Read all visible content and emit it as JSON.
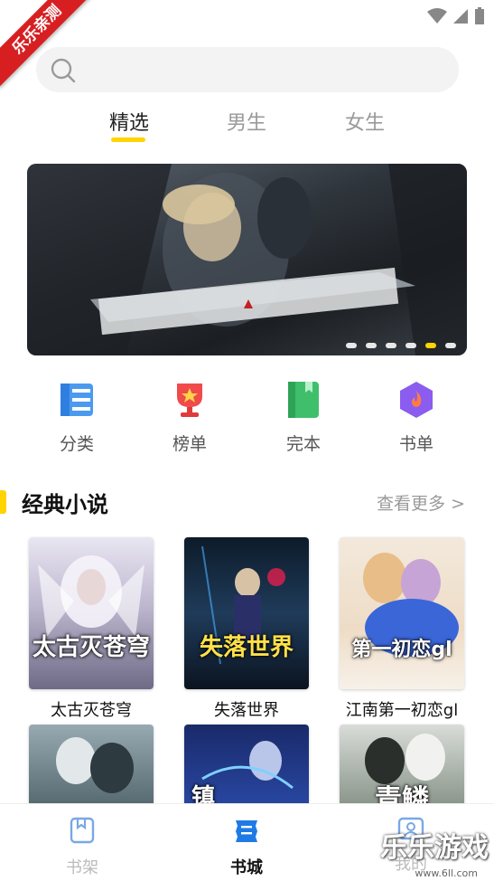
{
  "status_bar": {
    "ribbon_text": "乐乐亲测"
  },
  "search": {
    "placeholder": ""
  },
  "top_tabs": [
    {
      "label": "精选",
      "active": true
    },
    {
      "label": "男生",
      "active": false
    },
    {
      "label": "女生",
      "active": false
    }
  ],
  "banner": {
    "slides": 6,
    "active_slide": 5
  },
  "quick_entries": [
    {
      "label": "分类",
      "icon": "category-icon"
    },
    {
      "label": "榜单",
      "icon": "trophy-icon"
    },
    {
      "label": "完本",
      "icon": "finished-book-icon"
    },
    {
      "label": "书单",
      "icon": "booklist-icon"
    }
  ],
  "section": {
    "title": "经典小说",
    "more": "查看更多 >"
  },
  "books": [
    {
      "title": "太古灭苍穹",
      "cover_text": "太古灭苍穹"
    },
    {
      "title": "失落世界",
      "cover_text": "失落世界"
    },
    {
      "title": "江南第一初恋gl",
      "cover_text": "第一初恋gl"
    },
    {
      "title": "",
      "cover_text": ""
    },
    {
      "title": "",
      "cover_text": "镇"
    },
    {
      "title": "",
      "cover_text": "青鳞"
    }
  ],
  "bottom_nav": [
    {
      "label": "书架",
      "active": false,
      "icon": "bookshelf-icon"
    },
    {
      "label": "书城",
      "active": true,
      "icon": "bookstore-icon"
    },
    {
      "label": "我的",
      "active": false,
      "icon": "profile-icon"
    }
  ],
  "watermark": {
    "text": "乐乐游戏",
    "sub": "www.6ll.com"
  },
  "colors": {
    "accent": "#ffd400",
    "ribbon": "#d71f22"
  }
}
